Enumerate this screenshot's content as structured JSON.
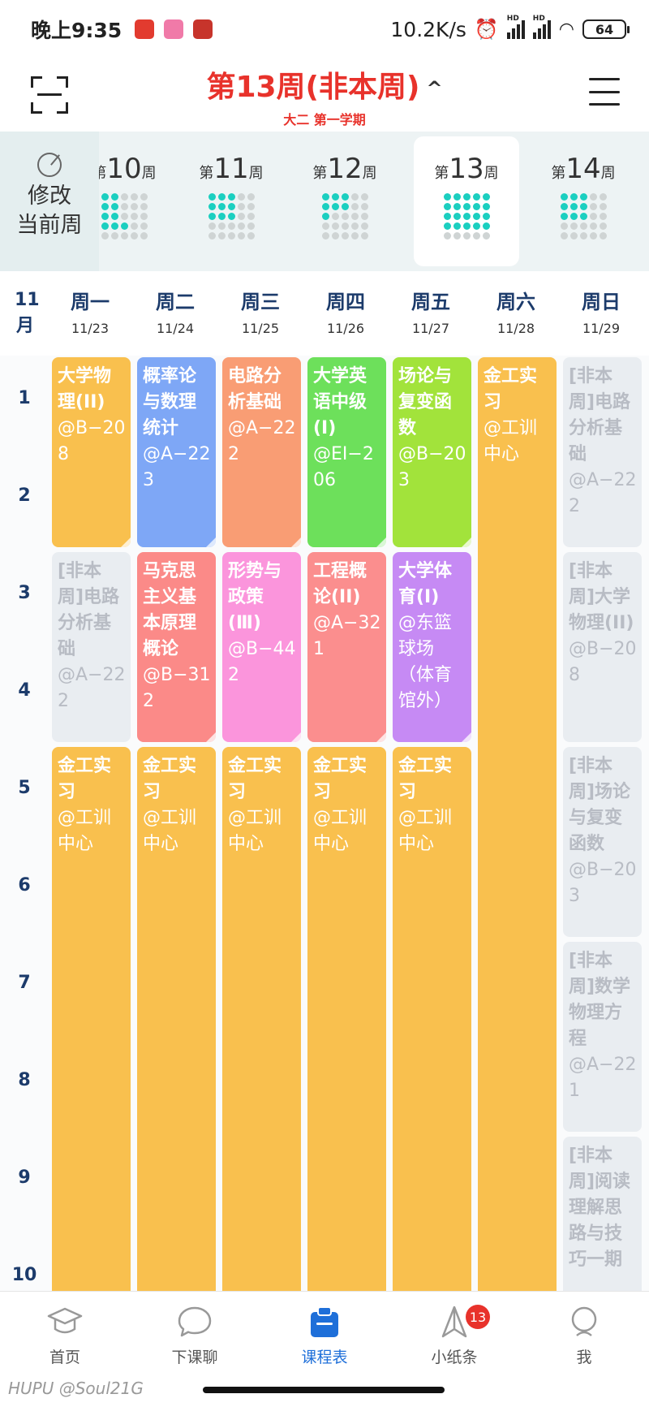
{
  "status_bar": {
    "time": "晚上9:35",
    "net_speed": "10.2K/s",
    "signal_tag": "HD",
    "battery": "64"
  },
  "header": {
    "week_title": "第13周(非本周)",
    "chevron": "^",
    "term": "大二 第一学期"
  },
  "week_selector": {
    "edit_label_line1": "修改",
    "edit_label_line2": "当前周",
    "weeks": [
      {
        "prefix": "第",
        "num": "10",
        "suffix": "周"
      },
      {
        "prefix": "第",
        "num": "11",
        "suffix": "周"
      },
      {
        "prefix": "第",
        "num": "12",
        "suffix": "周"
      },
      {
        "prefix": "第",
        "num": "13",
        "suffix": "周"
      },
      {
        "prefix": "第",
        "num": "14",
        "suffix": "周"
      }
    ]
  },
  "day_header": {
    "month_num": "11",
    "month_unit": "月",
    "days": [
      {
        "name": "周一",
        "date": "11/23"
      },
      {
        "name": "周二",
        "date": "11/24"
      },
      {
        "name": "周三",
        "date": "11/25"
      },
      {
        "name": "周四",
        "date": "11/26"
      },
      {
        "name": "周五",
        "date": "11/27"
      },
      {
        "name": "周六",
        "date": "11/28"
      },
      {
        "name": "周日",
        "date": "11/29"
      }
    ]
  },
  "periods": [
    "1",
    "2",
    "3",
    "4",
    "5",
    "6",
    "7",
    "8",
    "9",
    "10"
  ],
  "courses": [
    {
      "day": 0,
      "start": 1,
      "span": 2,
      "name": "大学物理(II)",
      "loc": "@B−208",
      "color": "#f9c04e"
    },
    {
      "day": 1,
      "start": 1,
      "span": 2,
      "name": "概率论与数理统计",
      "loc": "@A−223",
      "color": "#7ea7f6"
    },
    {
      "day": 2,
      "start": 1,
      "span": 2,
      "name": "电路分析基础",
      "loc": "@A−222",
      "color": "#f99d74"
    },
    {
      "day": 3,
      "start": 1,
      "span": 2,
      "name": "大学英语中级(I)",
      "loc": "@EI−206",
      "color": "#6de05b"
    },
    {
      "day": 4,
      "start": 1,
      "span": 2,
      "name": "场论与复变函数",
      "loc": "@B−203",
      "color": "#a2e33b"
    },
    {
      "day": 5,
      "start": 1,
      "span": 10,
      "name": "金工实习",
      "loc": "@工训中心",
      "color": "#f9c04e"
    },
    {
      "day": 6,
      "start": 1,
      "span": 2,
      "name": "[非本周]电路分析基础",
      "loc": "@A−222",
      "color": "#e9edf1",
      "nonweek": true
    },
    {
      "day": 0,
      "start": 3,
      "span": 2,
      "name": "[非本周]电路分析基础",
      "loc": "@A−222",
      "color": "#e9edf1",
      "nonweek": true
    },
    {
      "day": 1,
      "start": 3,
      "span": 2,
      "name": "马克思主义基本原理概论",
      "loc": "@B−312",
      "color": "#fb8a88"
    },
    {
      "day": 2,
      "start": 3,
      "span": 2,
      "name": "形势与政策(Ⅲ)",
      "loc": "@B−442",
      "color": "#fb95dc"
    },
    {
      "day": 3,
      "start": 3,
      "span": 2,
      "name": "工程概论(II)",
      "loc": "@A−321",
      "color": "#fb8e8e"
    },
    {
      "day": 4,
      "start": 3,
      "span": 2,
      "name": "大学体育(Ⅰ)",
      "loc": "@东篮球场（体育馆外）",
      "color": "#c68af4"
    },
    {
      "day": 6,
      "start": 3,
      "span": 2,
      "name": "[非本周]大学物理(II)",
      "loc": "@B−208",
      "color": "#e9edf1",
      "nonweek": true
    },
    {
      "day": 0,
      "start": 5,
      "span": 6,
      "name": "金工实习",
      "loc": "@工训中心",
      "color": "#f9c04e"
    },
    {
      "day": 1,
      "start": 5,
      "span": 6,
      "name": "金工实习",
      "loc": "@工训中心",
      "color": "#f9c04e"
    },
    {
      "day": 2,
      "start": 5,
      "span": 6,
      "name": "金工实习",
      "loc": "@工训中心",
      "color": "#f9c04e"
    },
    {
      "day": 3,
      "start": 5,
      "span": 6,
      "name": "金工实习",
      "loc": "@工训中心",
      "color": "#f9c04e"
    },
    {
      "day": 4,
      "start": 5,
      "span": 6,
      "name": "金工实习",
      "loc": "@工训中心",
      "color": "#f9c04e"
    },
    {
      "day": 6,
      "start": 5,
      "span": 2,
      "name": "[非本周]场论与复变函数",
      "loc": "@B−203",
      "color": "#e9edf1",
      "nonweek": true
    },
    {
      "day": 6,
      "start": 7,
      "span": 2,
      "name": "[非本周]数学物理方程",
      "loc": "@A−221",
      "color": "#e9edf1",
      "nonweek": true
    },
    {
      "day": 6,
      "start": 9,
      "span": 2,
      "name": "[非本周]阅读理解思路与技巧一期",
      "loc": "",
      "color": "#e9edf1",
      "nonweek": true
    }
  ],
  "bottom_nav": {
    "items": [
      {
        "label": "首页",
        "icon": "graduation-cap-icon"
      },
      {
        "label": "下课聊",
        "icon": "chat-bubble-icon"
      },
      {
        "label": "课程表",
        "icon": "schedule-clipboard-icon"
      },
      {
        "label": "小纸条",
        "icon": "paper-plane-icon"
      },
      {
        "label": "我",
        "icon": "profile-icon"
      }
    ],
    "badge": "13",
    "active_color": "#1e6fd9"
  },
  "watermark": "HUPU @Soul21G",
  "colors": {
    "accent_red": "#e8322b",
    "accent_blue": "#1e6fd9",
    "dot_active": "#1bcfc0"
  }
}
